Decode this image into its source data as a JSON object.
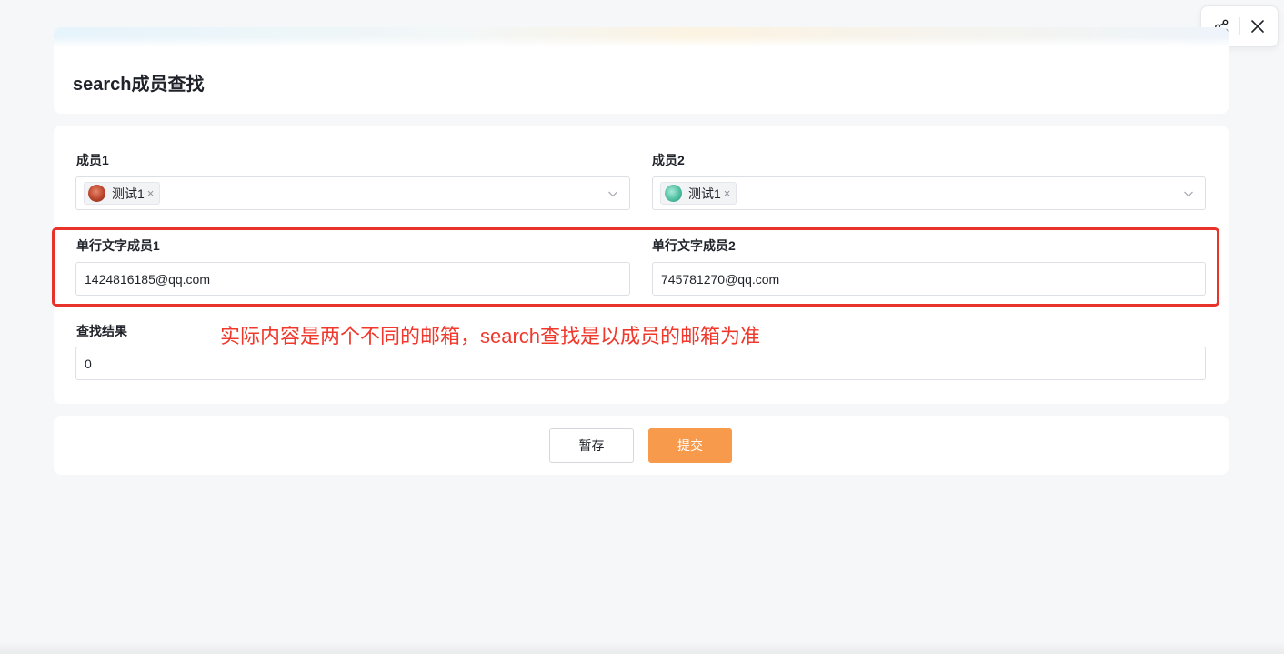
{
  "header": {
    "title": "search成员查找",
    "actions": [
      {
        "icon": "share-icon"
      },
      {
        "icon": "close-icon"
      }
    ]
  },
  "form": {
    "member1": {
      "label": "成员1",
      "tag": "测试1",
      "tag_close": "×"
    },
    "member2": {
      "label": "成员2",
      "tag": "测试1",
      "tag_close": "×"
    },
    "text_member1": {
      "label": "单行文字成员1",
      "value": "1424816185@qq.com"
    },
    "text_member2": {
      "label": "单行文字成员2",
      "value": "745781270@qq.com"
    },
    "result": {
      "label": "查找结果",
      "value": "0"
    },
    "annotation": "实际内容是两个不同的邮箱，search查找是以成员的邮箱为准"
  },
  "buttons": {
    "save": "暂存",
    "submit": "提交"
  },
  "colors": {
    "accent": "#f89a4b",
    "annotation": "#f0382c",
    "highlight_border": "#e8332a"
  }
}
